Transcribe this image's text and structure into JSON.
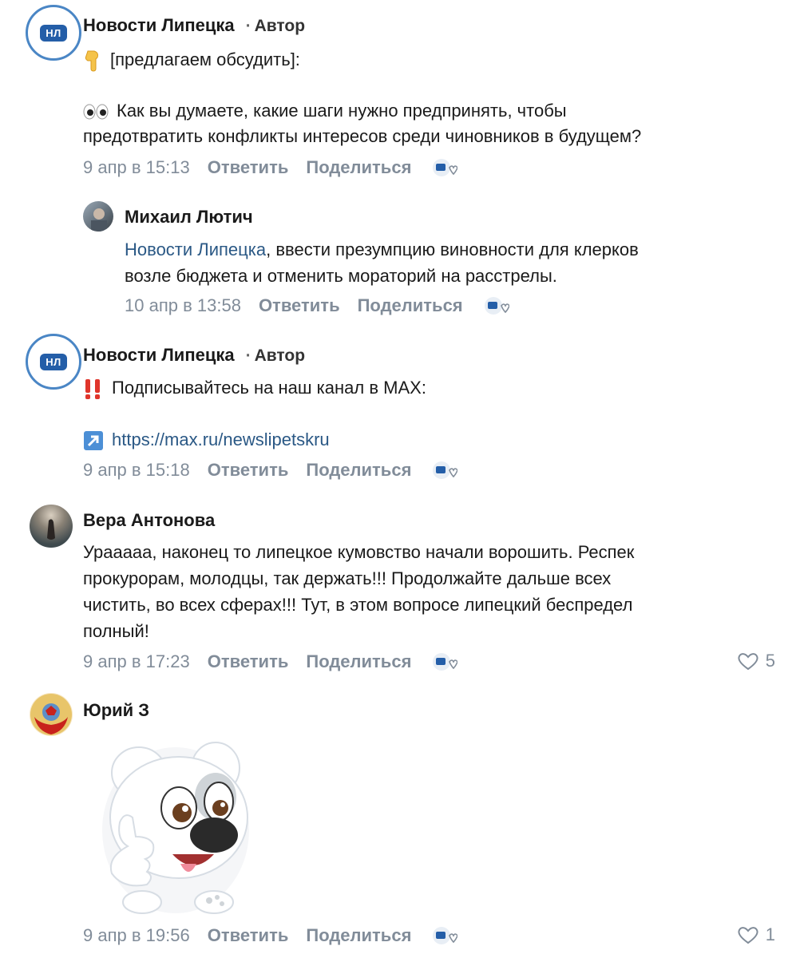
{
  "comments": [
    {
      "author": "Новости Липецка",
      "author_badge": "Автор",
      "avatar_text": "НЛ",
      "line1": "[предлагаем обсудить]:",
      "line2": "Как вы думаете, какие шаги нужно предпринять, чтобы",
      "line3": "предотвратить конфликты интересов среди чиновников в будущем?",
      "date": "9 апр в 15:13",
      "reply": "Ответить",
      "share": "Поделиться"
    },
    {
      "author": "Михаил Лютич",
      "mention": "Новости Липецка",
      "line1": ", ввести презумпцию виновности для клерков",
      "line2": "возле бюджета и отменить мораторий на расстрелы.",
      "date": "10 апр в 13:58",
      "reply": "Ответить",
      "share": "Поделиться"
    },
    {
      "author": "Новости Липецка",
      "author_badge": "Автор",
      "avatar_text": "НЛ",
      "line1": "Подписывайтесь на наш канал в MAX:",
      "link": "https://max.ru/newslipetskru",
      "date": "9 апр в 15:18",
      "reply": "Ответить",
      "share": "Поделиться"
    },
    {
      "author": "Вера Антонова",
      "line1": "Урааааа, наконец то липецкое кумовство начали ворошить. Респек",
      "line2": "прокурорам, молодцы, так держать!!! Продолжайте дальше всех",
      "line3": "чистить, во всех сферах!!! Тут, в этом вопросе липецкий беспредел",
      "line4": "полный!",
      "date": "9 апр в 17:23",
      "reply": "Ответить",
      "share": "Поделиться",
      "likes": "5"
    },
    {
      "author": "Юрий З",
      "date": "9 апр в 19:56",
      "reply": "Ответить",
      "share": "Поделиться",
      "likes": "1"
    }
  ],
  "icons": {
    "pointer": "point-down-emoji",
    "eyes": "eyes-emoji",
    "exclamation": "double-exclamation-emoji",
    "arrow": "arrow-up-right-emoji",
    "reaction": "reaction-icon",
    "heart": "heart-icon"
  },
  "colors": {
    "link": "#2a5885",
    "meta": "#818c99",
    "brand": "#245ea8"
  }
}
